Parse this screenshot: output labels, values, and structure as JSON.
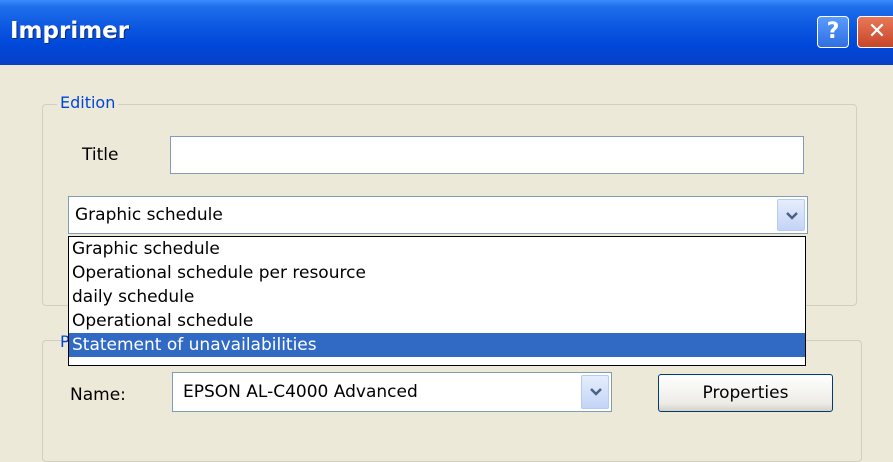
{
  "window": {
    "title": "Imprimer",
    "help_label": "?",
    "close_label": "✕"
  },
  "edition": {
    "legend": "Edition",
    "title_label": "Title",
    "title_value": "",
    "schedule_selected": "Graphic schedule",
    "schedule_options": [
      "Graphic schedule",
      "Operational schedule per resource",
      "daily schedule",
      "Operational schedule",
      "Statement of unavailabilities"
    ],
    "highlighted_option_index": 4
  },
  "printer": {
    "legend_partial": "P",
    "name_label": "Name:",
    "name_value": "EPSON AL-C4000 Advanced",
    "properties_label": "Properties"
  },
  "colors": {
    "titlebar": "#0A55E0",
    "selection": "#316AC5",
    "legend": "#0046D5",
    "dialog_bg": "#ECE9D8"
  },
  "icons": {
    "dropdown": "chevron-down-icon",
    "help": "help-icon",
    "close": "close-icon"
  }
}
